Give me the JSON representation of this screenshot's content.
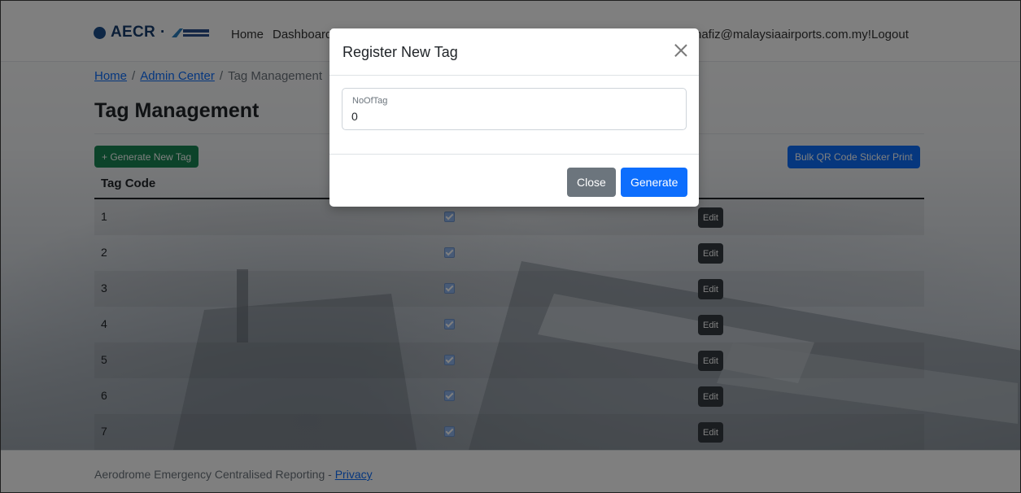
{
  "nav": {
    "brand": "AECR",
    "brand_separator": "·",
    "brand_logo_icon": "malaysia-airports-logo",
    "links": [
      "Home",
      "Dashboard"
    ],
    "user_greeting": "hafiz@malaysiaairports.com.my!",
    "logout": "Logout"
  },
  "breadcrumb": {
    "home": "Home",
    "sep1": "/",
    "admin": "Admin Center",
    "sep2": "/",
    "current": "Tag Management"
  },
  "page": {
    "title": "Tag Management",
    "generate_new_label": "+ Generate New Tag",
    "bulk_print_label": "Bulk QR Code Sticker Print"
  },
  "table": {
    "headers": {
      "tag_code": "Tag Code"
    },
    "edit_label": "Edit",
    "rows": [
      {
        "code": "1",
        "checked": true
      },
      {
        "code": "2",
        "checked": true
      },
      {
        "code": "3",
        "checked": true
      },
      {
        "code": "4",
        "checked": true
      },
      {
        "code": "5",
        "checked": true
      },
      {
        "code": "6",
        "checked": true
      },
      {
        "code": "7",
        "checked": true
      }
    ]
  },
  "footer": {
    "text": "Aerodrome Emergency Centralised Reporting - ",
    "privacy": "Privacy"
  },
  "modal": {
    "title": "Register New Tag",
    "field_label": "NoOfTag",
    "field_value": "0",
    "close_label": "Close",
    "generate_label": "Generate"
  },
  "colors": {
    "primary": "#0d6efd",
    "success": "#198754",
    "secondary": "#6c757d",
    "dark": "#343a40",
    "brand": "#173d6e"
  }
}
